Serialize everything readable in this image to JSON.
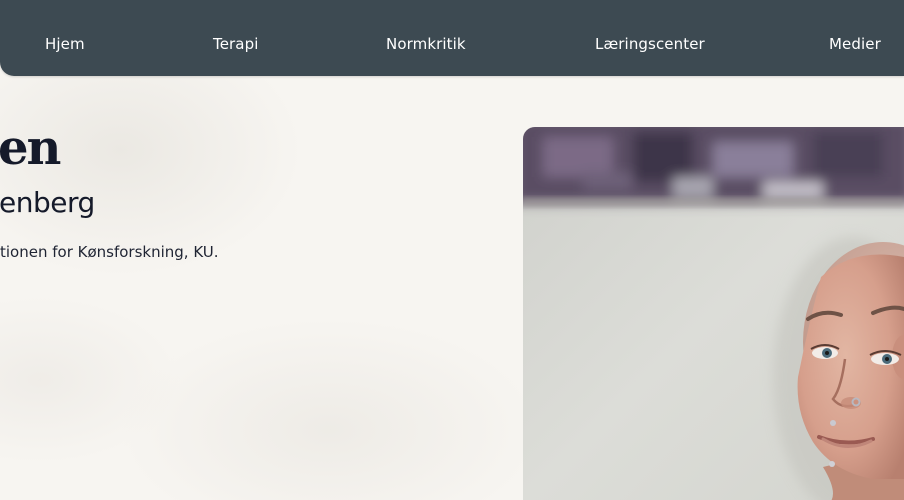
{
  "nav": {
    "items": [
      {
        "label": "Hjem"
      },
      {
        "label": "Terapi"
      },
      {
        "label": "Normkritik"
      },
      {
        "label": "Læringscenter"
      },
      {
        "label": "Medier"
      }
    ]
  },
  "hero": {
    "heading": "en",
    "subheading": "enberg",
    "text": "tionen for Kønsforskning, KU."
  },
  "colors": {
    "nav_background": "#3d4a52",
    "page_background": "#f7f5f1",
    "heading_text": "#151a2a"
  }
}
